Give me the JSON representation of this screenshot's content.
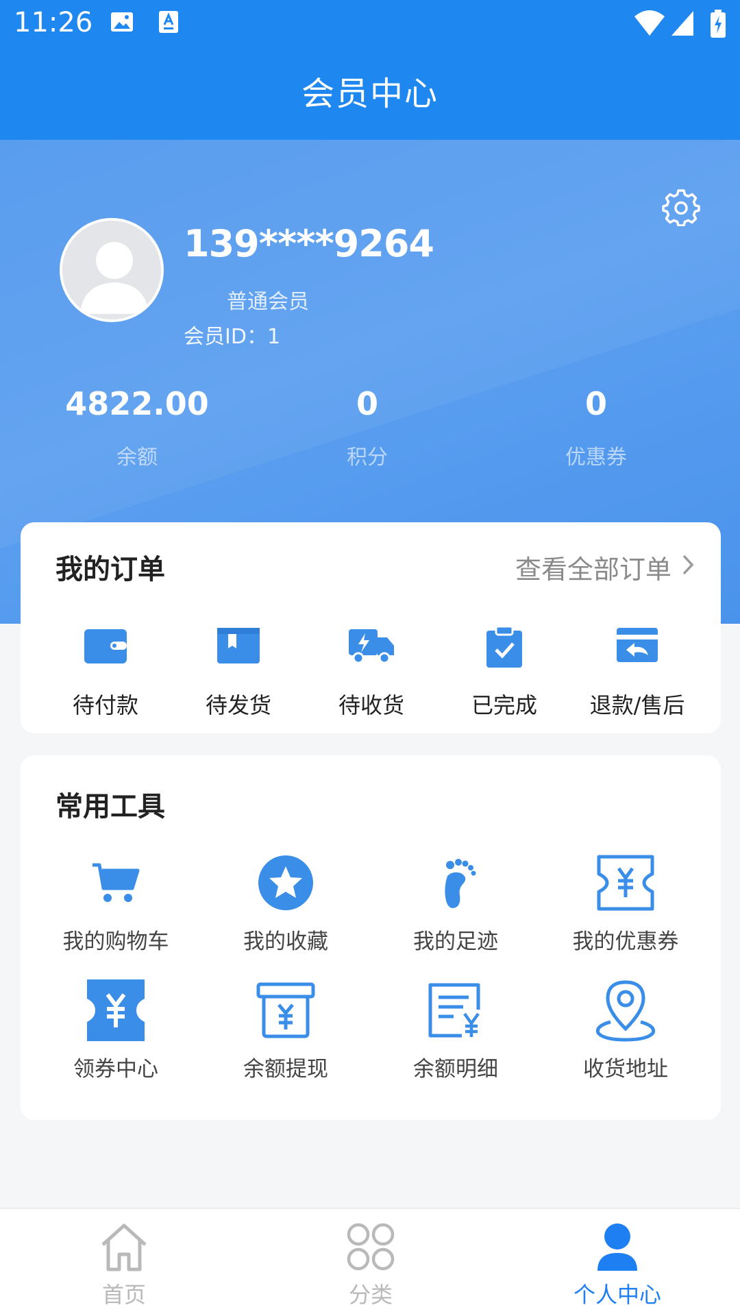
{
  "status_bar": {
    "time": "11:26"
  },
  "nav": {
    "title": "会员中心"
  },
  "profile": {
    "phone": "139****9264",
    "level": "普通会员",
    "member_id": "会员ID：1"
  },
  "stats": [
    {
      "value": "4822.00",
      "label": "余额"
    },
    {
      "value": "0",
      "label": "积分"
    },
    {
      "value": "0",
      "label": "优惠券"
    }
  ],
  "orders": {
    "title": "我的订单",
    "view_all": "查看全部订单",
    "items": [
      {
        "label": "待付款",
        "icon": "wallet-icon"
      },
      {
        "label": "待发货",
        "icon": "box-icon"
      },
      {
        "label": "待收货",
        "icon": "truck-icon"
      },
      {
        "label": "已完成",
        "icon": "clipboard-check-icon"
      },
      {
        "label": "退款/售后",
        "icon": "refund-icon"
      }
    ]
  },
  "tools": {
    "title": "常用工具",
    "items": [
      {
        "label": "我的购物车",
        "icon": "cart-icon"
      },
      {
        "label": "我的收藏",
        "icon": "star-icon"
      },
      {
        "label": "我的足迹",
        "icon": "footprint-icon"
      },
      {
        "label": "我的优惠券",
        "icon": "coupon-icon"
      },
      {
        "label": "领券中心",
        "icon": "coupon-center-icon"
      },
      {
        "label": "余额提现",
        "icon": "withdraw-icon"
      },
      {
        "label": "余额明细",
        "icon": "balance-detail-icon"
      },
      {
        "label": "收货地址",
        "icon": "location-icon"
      }
    ]
  },
  "tabbar": {
    "items": [
      {
        "label": "首页",
        "icon": "home-icon"
      },
      {
        "label": "分类",
        "icon": "category-icon"
      },
      {
        "label": "个人中心",
        "icon": "user-icon"
      }
    ],
    "active": "个人中心"
  },
  "colors": {
    "primary": "#1e88f0",
    "icon_blue": "#3a8ee8",
    "tab_active": "#1e7ff2",
    "tab_inactive": "#b9b9b9"
  }
}
